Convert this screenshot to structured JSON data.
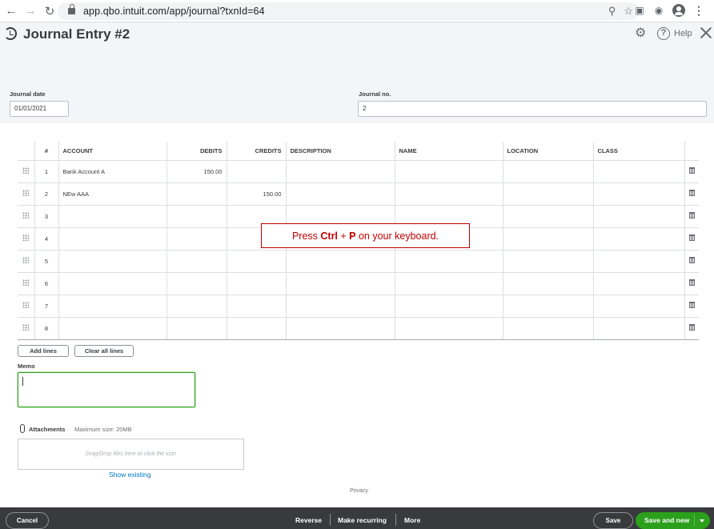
{
  "browser": {
    "url": "app.qbo.intuit.com/app/journal?txnId=64"
  },
  "header": {
    "title": "Journal Entry #2",
    "help_label": "Help"
  },
  "form": {
    "journal_date_label": "Journal date",
    "journal_date_value": "01/01/2021",
    "journal_no_label": "Journal no.",
    "journal_no_value": "2"
  },
  "table": {
    "columns": [
      "#",
      "ACCOUNT",
      "DEBITS",
      "CREDITS",
      "DESCRIPTION",
      "NAME",
      "LOCATION",
      "CLASS"
    ],
    "rows": [
      {
        "n": "1",
        "account": "Bank Account A",
        "debits": "150.00",
        "credits": "",
        "description": "",
        "name": "",
        "location": "",
        "class": ""
      },
      {
        "n": "2",
        "account": "NEw AAA",
        "debits": "",
        "credits": "150.00",
        "description": "",
        "name": "",
        "location": "",
        "class": ""
      },
      {
        "n": "3",
        "account": "",
        "debits": "",
        "credits": "",
        "description": "",
        "name": "",
        "location": "",
        "class": ""
      },
      {
        "n": "4",
        "account": "",
        "debits": "",
        "credits": "",
        "description": "",
        "name": "",
        "location": "",
        "class": ""
      },
      {
        "n": "5",
        "account": "",
        "debits": "",
        "credits": "",
        "description": "",
        "name": "",
        "location": "",
        "class": ""
      },
      {
        "n": "6",
        "account": "",
        "debits": "",
        "credits": "",
        "description": "",
        "name": "",
        "location": "",
        "class": ""
      },
      {
        "n": "7",
        "account": "",
        "debits": "",
        "credits": "",
        "description": "",
        "name": "",
        "location": "",
        "class": ""
      },
      {
        "n": "8",
        "account": "",
        "debits": "",
        "credits": "",
        "description": "",
        "name": "",
        "location": "",
        "class": ""
      }
    ]
  },
  "callout": {
    "prefix": "Press ",
    "key1": "Ctrl",
    "plus": " + ",
    "key2": "P",
    "suffix": " on your keyboard."
  },
  "actions": {
    "add_lines": "Add lines",
    "clear_all_lines": "Clear all lines"
  },
  "memo": {
    "label": "Memo",
    "value": ""
  },
  "attachments": {
    "label": "Attachments",
    "max_size": "Maximum size: 20MB",
    "drop_hint": "Drag/Drop files here or click the icon",
    "show_existing": "Show existing"
  },
  "privacy": "Privacy",
  "footer": {
    "cancel": "Cancel",
    "reverse": "Reverse",
    "make_recurring": "Make recurring",
    "more": "More",
    "save": "Save",
    "save_and_new": "Save and new"
  },
  "colors": {
    "accent_green": "#2ca01c",
    "footer_bg": "#393a3d",
    "link_blue": "#0077c5",
    "callout_red": "#c00000"
  }
}
